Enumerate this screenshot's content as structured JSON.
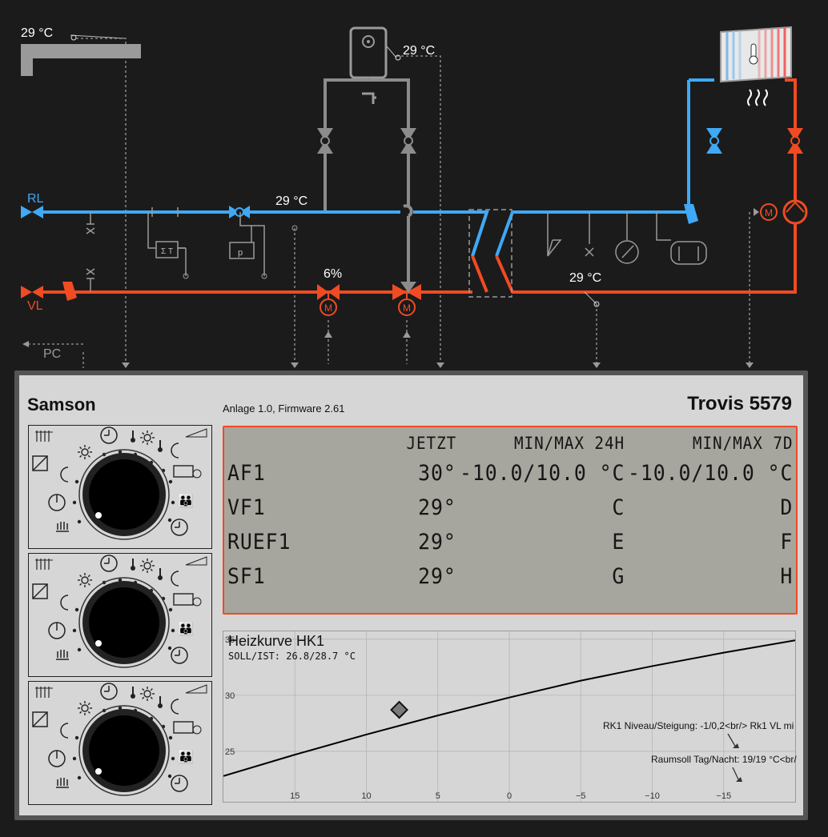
{
  "scheme": {
    "temp_outdoor": "29 °C",
    "temp_storage": "29 °C",
    "temp_return": "29 °C",
    "temp_flow_secondary": "29 °C",
    "valve_position": "6%",
    "label_return": "RL",
    "label_flow": "VL",
    "label_pc": "PC",
    "motor_symbol": "M",
    "sensor_sum_label": "Σ T",
    "sensor_pressure_label": "p",
    "color_supply": "#f04b23",
    "color_return": "#3fa9f5",
    "color_pipe_grey": "#8c8c8c"
  },
  "panel": {
    "brand": "Samson",
    "model": "Trovis 5579",
    "subtitle": "Anlage 1.0, Firmware 2.61"
  },
  "lcd": {
    "headers": [
      "JETZT",
      "MIN/MAX 24H",
      "MIN/MAX 7D"
    ],
    "rows": [
      {
        "name": "AF1",
        "now": "30°",
        "day": "-10.0/10.0 °C",
        "week": "-10.0/10.0 °C"
      },
      {
        "name": "VF1",
        "now": "29°",
        "day": "C",
        "week": "D"
      },
      {
        "name": "RUEF1",
        "now": "29°",
        "day": "E",
        "week": "F"
      },
      {
        "name": "SF1",
        "now": "29°",
        "day": "G",
        "week": "H"
      }
    ]
  },
  "chart_title": "Heizkurve HK1",
  "chart_subtitle": "SOLL/IST: 26.8/28.7 °C",
  "chart_note_1": "RK1 Niveau/Steigung: -1/0,2<br/> Rk1 VL mi",
  "chart_note_2": "Raumsoll Tag/Nacht: 19/19 °C<br/",
  "chart_data": {
    "type": "line",
    "x_ticks": [
      15,
      10,
      5,
      0,
      -5,
      -10,
      -15
    ],
    "x_tick_labels": [
      "15",
      "10",
      "5",
      "0",
      "−5",
      "−10",
      "−15"
    ],
    "y_ticks": [
      25,
      30,
      35
    ],
    "xlim": [
      20,
      -20
    ],
    "ylim": [
      20.5,
      35.7
    ],
    "grid": true,
    "series": [
      {
        "x": [
          20,
          15,
          10,
          5,
          0,
          -5,
          -10,
          -15,
          -20
        ],
        "y": [
          22.8,
          24.7,
          26.5,
          28.2,
          29.8,
          31.3,
          32.6,
          33.8,
          34.9
        ]
      }
    ],
    "marker": {
      "x": 7.7,
      "y": 28.7,
      "shape": "diamond"
    }
  }
}
